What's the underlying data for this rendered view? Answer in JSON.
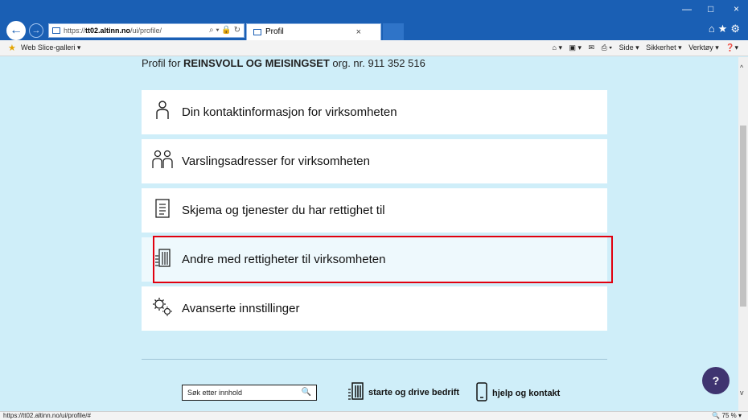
{
  "browser": {
    "address_prefix": "https://",
    "address_host": "tt02.altinn.no",
    "address_path": "/ui/profile/",
    "address_tools": "⌕ ▾ 🔒 ↻",
    "tab_title": "Profil",
    "tab_close": "×",
    "minimize": "—",
    "maximize": "□",
    "close": "×",
    "top_icons": "⌂★⚙"
  },
  "command_bar": {
    "web_slice": "Web Slice-galleri ▾",
    "home": "⌂ ▾",
    "feeds": "▣ ▾",
    "mail": "✉",
    "print": "⎙ ▾",
    "side": "Side ▾",
    "sikkerhet": "Sikkerhet ▾",
    "verktoy": "Verktøy ▾",
    "help": "❓▾"
  },
  "page": {
    "header_prefix": "Profil for ",
    "header_org": "REINSVOLL OG MEISINGSET",
    "header_suffix": " org. nr. 911 352 516",
    "menu": [
      {
        "label": "Din kontaktinformasjon for virksomheten",
        "icon": "person-icon"
      },
      {
        "label": "Varslingsadresser for virksomheten",
        "icon": "people-icon"
      },
      {
        "label": "Skjema og tjenester du har rettighet til",
        "icon": "document-icon"
      },
      {
        "label": "Andre med rettigheter til virksomheten",
        "icon": "building-icon"
      },
      {
        "label": "Avanserte innstillinger",
        "icon": "gears-icon"
      }
    ]
  },
  "footer": {
    "search_label": "Søk etter innhold",
    "start_link": "starte og drive bedrift",
    "help_link": "hjelp og kontakt",
    "help_button": "?"
  },
  "status": {
    "url": "https://tt02.altinn.no/ui/profile/#",
    "zoom": "🔍 75 %  ▾"
  },
  "colors": {
    "title_bar": "#1a5fb4",
    "background": "#cfeef9",
    "selection": "#e1000f",
    "help_button": "#3f3470"
  }
}
